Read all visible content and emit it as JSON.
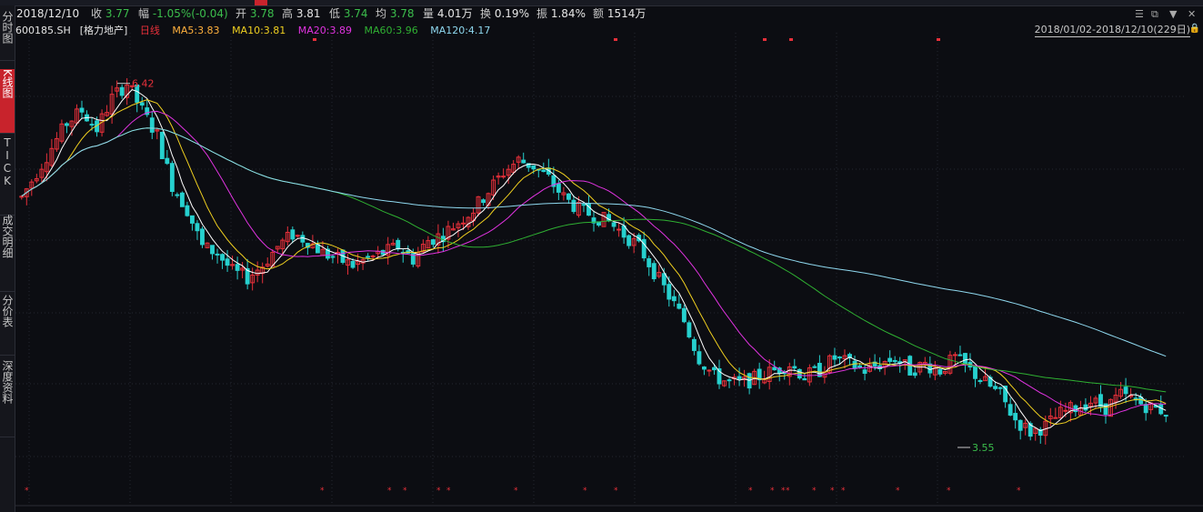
{
  "info": {
    "date": "2018/12/10",
    "close_label": "收",
    "close": "3.77",
    "change_label": "幅",
    "change": "-1.05%(-0.04)",
    "open_label": "开",
    "open": "3.78",
    "high_label": "高",
    "high": "3.81",
    "low_label": "低",
    "low": "3.74",
    "avg_label": "均",
    "avg": "3.78",
    "volume_label": "量",
    "volume": "4.01万",
    "turnover_label": "换",
    "turnover": "0.19%",
    "amplitude_label": "振",
    "amplitude": "1.84%",
    "amount_label": "额",
    "amount": "1514万"
  },
  "sidebar": {
    "tabs": [
      {
        "label": "分时图"
      },
      {
        "label": "K线图"
      },
      {
        "label": "TICK"
      },
      {
        "label": "成交明细"
      },
      {
        "label": "分价表"
      },
      {
        "label": "深度资料"
      }
    ]
  },
  "legend": {
    "symbol": "600185.SH",
    "name": "[格力地产]",
    "period": "日线",
    "ma5": "MA5:3.83",
    "ma10": "MA10:3.81",
    "ma20": "MA20:3.89",
    "ma60": "MA60:3.96",
    "ma120": "MA120:4.17"
  },
  "date_range": "2018/01/02-2018/12/10(229日)",
  "annotations": {
    "high": "6.42",
    "low": "3.55"
  },
  "colors": {
    "up": "#e8303a",
    "down": "#26d0ce",
    "ma5": "#ffffff",
    "ma10": "#f0d020",
    "ma20": "#e033e0",
    "ma60": "#2fb032",
    "ma120": "#8fd8ef",
    "accent": "#c8232c"
  },
  "chart_data": {
    "type": "candlestick",
    "ylim": [
      3.3,
      6.8
    ],
    "highest": 6.42,
    "lowest": 3.55,
    "days": 229,
    "close_path": [
      5.5,
      5.7,
      5.9,
      6.1,
      6.2,
      6.05,
      6.3,
      6.42,
      6.2,
      6.0,
      5.6,
      5.4,
      5.1,
      5.05,
      4.9,
      4.85,
      4.95,
      5.1,
      5.2,
      5.15,
      5.05,
      5.0,
      4.95,
      5.0,
      5.05,
      5.1,
      5.0,
      5.15,
      5.2,
      5.3,
      5.4,
      5.55,
      5.7,
      5.8,
      5.75,
      5.65,
      5.5,
      5.4,
      5.35,
      5.3,
      5.2,
      5.1,
      4.9,
      4.7,
      4.5,
      4.2,
      4.05,
      4.0,
      4.0,
      4.05,
      4.1,
      4.15,
      4.05,
      4.1,
      4.2,
      4.15,
      4.1,
      4.15,
      4.2,
      4.1,
      4.15,
      4.1,
      4.2,
      4.1,
      4.0,
      3.9,
      3.7,
      3.6,
      3.65,
      3.75,
      3.8,
      3.85,
      3.8,
      3.9,
      3.85,
      3.8,
      3.77
    ]
  }
}
